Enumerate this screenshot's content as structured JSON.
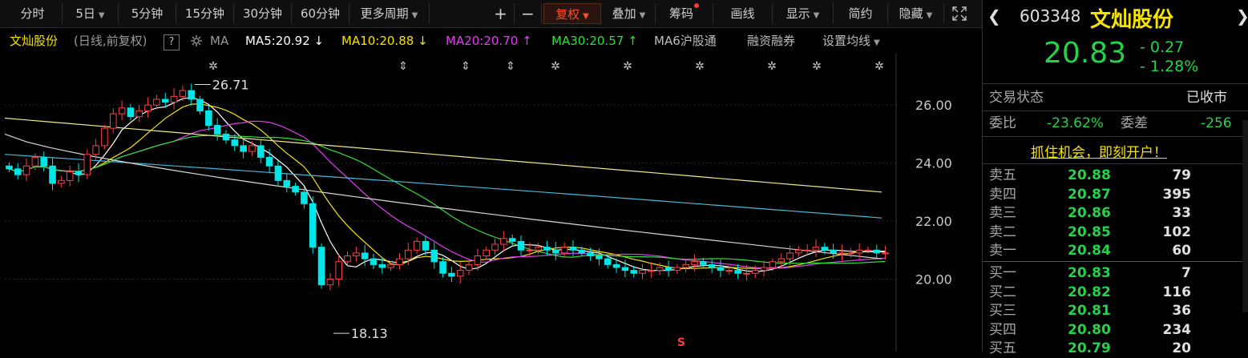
{
  "toolbar": {
    "items": [
      {
        "label": "分时",
        "caret": false
      },
      {
        "label": "5日",
        "caret": true
      },
      {
        "label": "5分钟",
        "caret": false
      },
      {
        "label": "15分钟",
        "caret": false
      },
      {
        "label": "30分钟",
        "caret": false
      },
      {
        "label": "60分钟",
        "caret": false
      },
      {
        "label": "更多周期",
        "caret": true
      }
    ],
    "zoom_in": "+",
    "zoom_out": "−",
    "fuquan": "复权",
    "diejia": "叠加",
    "chouma": "筹码",
    "huaxian": "画线",
    "xianshi": "显示",
    "jianyue": "简约",
    "yincang": "隐藏",
    "fullscreen_icon": "fullscreen-icon"
  },
  "ma_bar": {
    "stock_name": "文灿股份",
    "mode": "(日线,前复权)",
    "help": "?",
    "ma_label": "MA",
    "ma5": "MA5:20.92",
    "ma5_arrow": "↓",
    "ma10": "MA10:20.88",
    "ma10_arrow": "↓",
    "ma20": "MA20:20.70",
    "ma20_arrow": "↑",
    "ma30": "MA30:20.57",
    "ma30_arrow": "↑",
    "ma6": "MA6沪股通",
    "rzrq": "融资融券",
    "settings": "设置均线",
    "colors": {
      "ma5": "#ffffff",
      "ma10": "#f5e400",
      "ma20": "#e23ef0",
      "ma30": "#2ee03a"
    }
  },
  "chart_data": {
    "type": "candlestick",
    "y_ticks": [
      "26.00",
      "24.00",
      "22.00",
      "20.00"
    ],
    "ylim": [
      17.5,
      27.8
    ],
    "high_label": "26.71",
    "low_label": "18.13",
    "high_value": 26.71,
    "low_value": 18.13,
    "marker_s": "S",
    "closes": [
      23.8,
      23.6,
      23.9,
      24.2,
      23.9,
      23.3,
      23.4,
      23.7,
      23.6,
      24.3,
      24.6,
      25.2,
      25.7,
      25.9,
      25.6,
      25.8,
      26.0,
      26.2,
      26.1,
      26.3,
      26.5,
      26.2,
      25.8,
      25.3,
      25.0,
      24.8,
      24.6,
      24.4,
      24.6,
      24.2,
      23.9,
      23.4,
      23.2,
      23.0,
      22.6,
      21.1,
      19.8,
      20.0,
      20.6,
      20.8,
      20.9,
      20.7,
      20.5,
      20.4,
      20.5,
      20.7,
      21.0,
      21.3,
      21.0,
      20.6,
      20.2,
      20.1,
      20.3,
      20.5,
      20.8,
      21.0,
      21.2,
      21.4,
      21.3,
      21.0,
      21.0,
      21.1,
      21.0,
      20.9,
      21.1,
      21.0,
      20.9,
      20.8,
      20.7,
      20.5,
      20.4,
      20.3,
      20.2,
      20.3,
      20.3,
      20.4,
      20.3,
      20.4,
      20.5,
      20.6,
      20.5,
      20.4,
      20.3,
      20.3,
      20.2,
      20.2,
      20.3,
      20.4,
      20.6,
      20.7,
      20.9,
      21.0,
      21.0,
      21.1,
      21.0,
      20.9,
      20.9,
      20.9,
      21.0,
      21.0,
      20.9,
      20.9
    ],
    "ma_series": [
      {
        "name": "MA5",
        "color": "#ffffff"
      },
      {
        "name": "MA10",
        "color": "#f5e400"
      },
      {
        "name": "MA20",
        "color": "#e23ef0"
      },
      {
        "name": "MA30",
        "color": "#2ee03a"
      }
    ],
    "long_ma": [
      {
        "color": "#f0ea8c",
        "from": 25.55,
        "to": 23.0
      },
      {
        "color": "#4ab8d8",
        "from": 24.3,
        "to": 22.1
      },
      {
        "color": "#d8d8d8",
        "from": 25.0,
        "to": 20.7
      }
    ]
  },
  "panel": {
    "code": "603348",
    "name": "文灿股份",
    "price": "20.83",
    "change": "- 0.27",
    "change_pct": "- 1.28%",
    "status_label": "交易状态",
    "status_value": "已收市",
    "weibi_label": "委比",
    "weibi_value": "-23.62%",
    "weicha_label": "委差",
    "weicha_value": "-256",
    "promo": "抓住机会，即刻开户！",
    "asks": [
      {
        "label": "卖五",
        "price": "20.88",
        "vol": "79"
      },
      {
        "label": "卖四",
        "price": "20.87",
        "vol": "395"
      },
      {
        "label": "卖三",
        "price": "20.86",
        "vol": "33"
      },
      {
        "label": "卖二",
        "price": "20.85",
        "vol": "102"
      },
      {
        "label": "卖一",
        "price": "20.84",
        "vol": "60"
      }
    ],
    "bids": [
      {
        "label": "买一",
        "price": "20.83",
        "vol": "7"
      },
      {
        "label": "买二",
        "price": "20.82",
        "vol": "116"
      },
      {
        "label": "买三",
        "price": "20.81",
        "vol": "36"
      },
      {
        "label": "买四",
        "price": "20.80",
        "vol": "234"
      },
      {
        "label": "买五",
        "price": "20.79",
        "vol": "20"
      }
    ]
  }
}
